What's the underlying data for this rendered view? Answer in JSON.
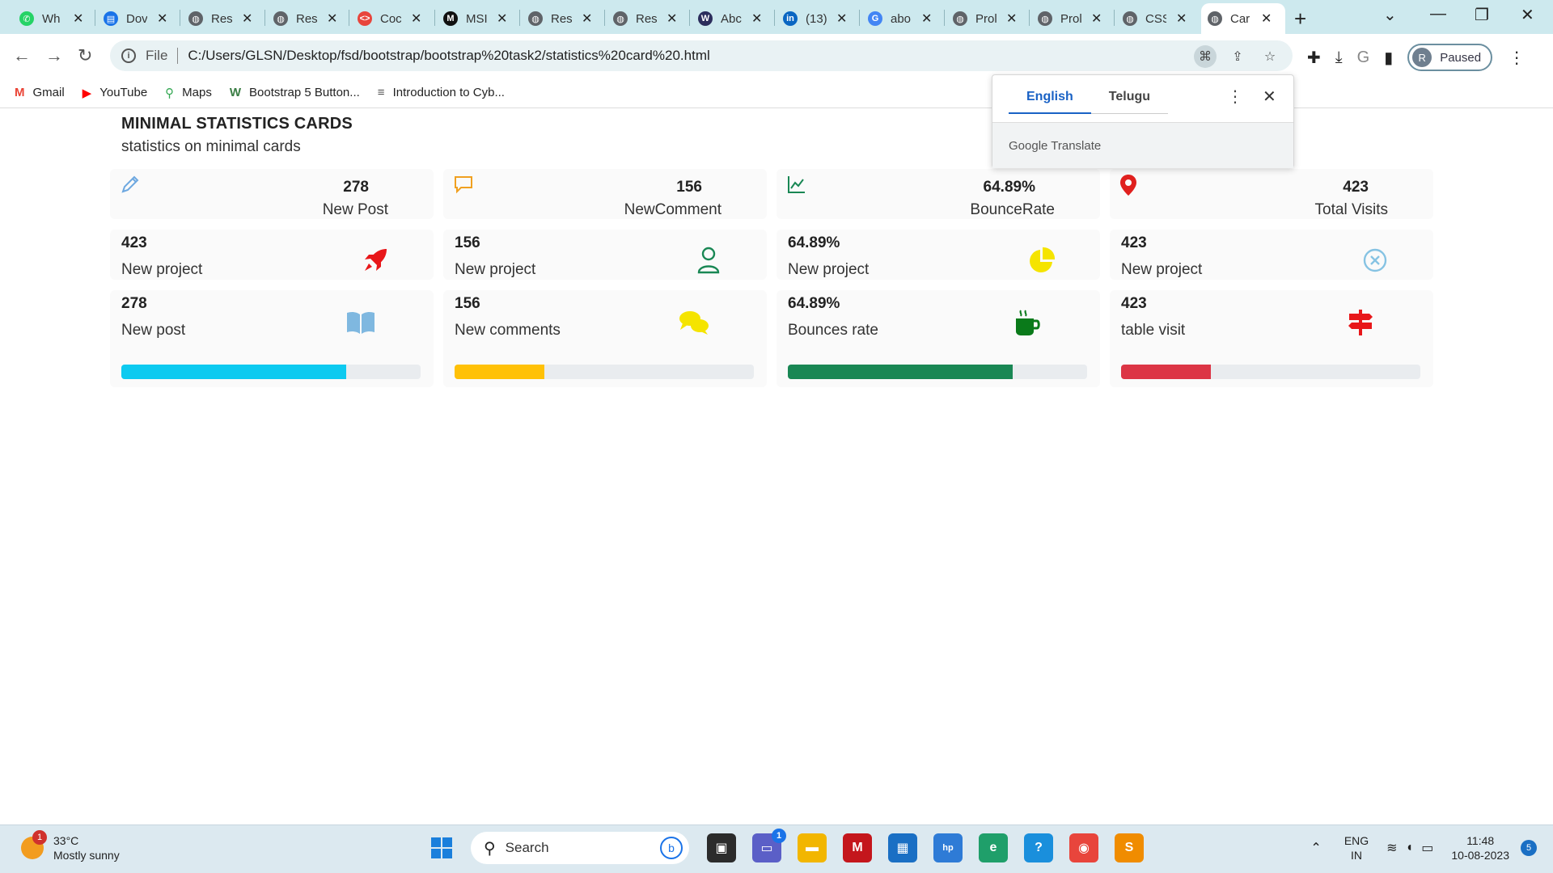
{
  "browser": {
    "tabs": [
      {
        "label": "Wh",
        "color": "#25d366",
        "glyph": "✆"
      },
      {
        "label": "Dov",
        "color": "#1a73e8",
        "glyph": "▤"
      },
      {
        "label": "Resi",
        "color": "#5f6368",
        "glyph": "◍"
      },
      {
        "label": "Resi",
        "color": "#5f6368",
        "glyph": "◍"
      },
      {
        "label": "Coc",
        "color": "#e8453c",
        "glyph": "<>"
      },
      {
        "label": "MSI",
        "color": "#111111",
        "glyph": "M"
      },
      {
        "label": "Res",
        "color": "#5f6368",
        "glyph": "◍"
      },
      {
        "label": "Resi",
        "color": "#5f6368",
        "glyph": "◍"
      },
      {
        "label": "Abc",
        "color": "#2b2d5c",
        "glyph": "W"
      },
      {
        "label": "(13)",
        "color": "#0a66c2",
        "glyph": "in"
      },
      {
        "label": "abo",
        "color": "#4285f4",
        "glyph": "G"
      },
      {
        "label": "Prol",
        "color": "#5f6368",
        "glyph": "◍"
      },
      {
        "label": "Prol",
        "color": "#5f6368",
        "glyph": "◍"
      },
      {
        "label": "CSS",
        "color": "#5f6368",
        "glyph": "◍"
      },
      {
        "label": "Car",
        "color": "#5f6368",
        "glyph": "◍"
      }
    ],
    "address": {
      "scheme": "File",
      "url": "C:/Users/GLSN/Desktop/fsd/bootstrap/bootstrap%20task2/statistics%20card%20.html"
    },
    "profile": {
      "initial": "R",
      "status": "Paused"
    },
    "bookmarks": [
      {
        "label": "Gmail",
        "icon": "M",
        "color": "#ea4335"
      },
      {
        "label": "YouTube",
        "icon": "▶",
        "color": "#ff0000"
      },
      {
        "label": "Maps",
        "icon": "⚲",
        "color": "#34a853"
      },
      {
        "label": "Bootstrap 5 Button...",
        "icon": "W",
        "color": "#3a7d44"
      },
      {
        "label": "Introduction to Cyb...",
        "icon": "≡",
        "color": "#555555"
      }
    ]
  },
  "translate_popup": {
    "languages": [
      "English",
      "Telugu"
    ],
    "footer": "Google Translate"
  },
  "page": {
    "title": "MINIMAL STATISTICS CARDS",
    "subtitle": "statistics on minimal cards",
    "row1": [
      {
        "value": "278",
        "label": "New Post",
        "icon": "pencil-icon",
        "color": "#6ea8e0"
      },
      {
        "value": "156",
        "label": "NewComment",
        "icon": "comment-icon",
        "color": "#f0a020"
      },
      {
        "value": "64.89%",
        "label": "BounceRate",
        "icon": "chart-line-icon",
        "color": "#198754"
      },
      {
        "value": "423",
        "label": "Total Visits",
        "icon": "map-pin-icon",
        "color": "#e0201e"
      }
    ],
    "row2": [
      {
        "value": "423",
        "label": "New project",
        "icon": "rocket-icon",
        "color": "#e8171a"
      },
      {
        "value": "156",
        "label": "New project",
        "icon": "user-icon",
        "color": "#198754"
      },
      {
        "value": "64.89%",
        "label": "New project",
        "icon": "pie-chart-icon",
        "color": "#f5e400"
      },
      {
        "value": "423",
        "label": "New project",
        "icon": "circle-x-icon",
        "color": "#86c3e3"
      }
    ],
    "row3": [
      {
        "value": "278",
        "label": "New post",
        "icon": "book-icon",
        "color": "#7fb8e0",
        "progress": 0.75,
        "bar": "#0dcaf0"
      },
      {
        "value": "156",
        "label": "New comments",
        "icon": "comments-icon",
        "color": "#f5e400",
        "progress": 0.3,
        "bar": "#ffc107"
      },
      {
        "value": "64.89%",
        "label": "Bounces rate",
        "icon": "mug-icon",
        "color": "#0a7a1a",
        "progress": 0.75,
        "bar": "#198754"
      },
      {
        "value": "423",
        "label": "table visit",
        "icon": "signpost-icon",
        "color": "#e8171a",
        "progress": 0.3,
        "bar": "#dc3545"
      }
    ]
  },
  "taskbar": {
    "weather": {
      "temp": "33°C",
      "desc": "Mostly sunny",
      "badge": "1"
    },
    "search_label": "Search",
    "lang": {
      "line1": "ENG",
      "line2": "IN"
    },
    "time": "11:48",
    "date": "10-08-2023",
    "notif": "5",
    "chat_badge": "1"
  }
}
